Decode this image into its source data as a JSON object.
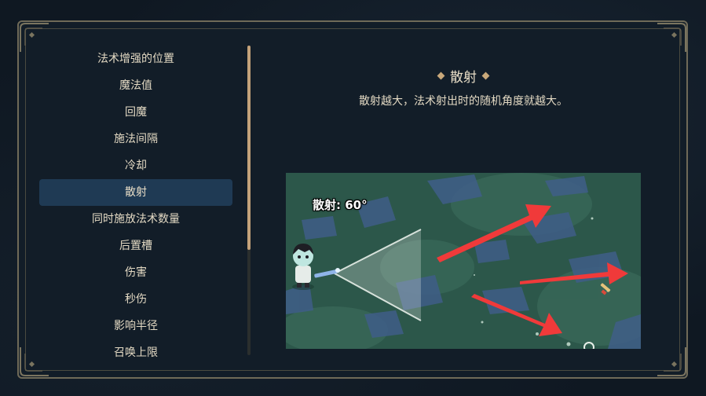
{
  "menu": {
    "items": [
      {
        "label": "法术增强的位置"
      },
      {
        "label": "魔法值"
      },
      {
        "label": "回魔"
      },
      {
        "label": "施法间隔"
      },
      {
        "label": "冷却"
      },
      {
        "label": "散射"
      },
      {
        "label": "同时施放法术数量"
      },
      {
        "label": "后置槽"
      },
      {
        "label": "伤害"
      },
      {
        "label": "秒伤"
      },
      {
        "label": "影响半径"
      },
      {
        "label": "召唤上限"
      }
    ],
    "selected_index": 5
  },
  "detail": {
    "title": "散射",
    "description": "散射越大，法术射出时的随机角度就越大。",
    "preview": {
      "spread_label": "散射: 60°"
    }
  },
  "colors": {
    "accent_gold": "#c8a87a",
    "selected_row": "#1f3a54",
    "text": "#e3d9c3",
    "arrow_red": "#f03a3a",
    "ground": "#2e5a4c"
  }
}
